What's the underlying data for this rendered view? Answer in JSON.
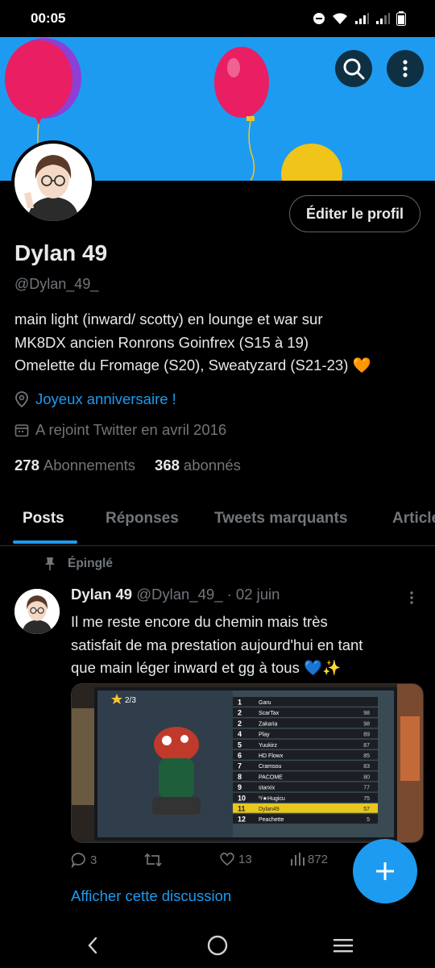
{
  "status_bar": {
    "time": "00:05"
  },
  "profile": {
    "edit_button": "Éditer le profil",
    "display_name": "Dylan 49",
    "handle": "@Dylan_49_",
    "bio_lines": [
      "main light (inward/ scotty) en lounge et war sur",
      "MK8DX  ancien Ronrons Goinfrex (S15 à 19)",
      "Omelette du Fromage (S20), Sweatyzard (S21-23) 🧡"
    ],
    "location": "Joyeux anniversaire !",
    "joined": "A rejoint Twitter en avril 2016",
    "following_count": "278",
    "following_label": "Abonnements",
    "followers_count": "368",
    "followers_label": "abonnés"
  },
  "tabs": [
    {
      "label": "Posts",
      "active": true
    },
    {
      "label": "Réponses",
      "active": false
    },
    {
      "label": "Tweets marquants",
      "active": false
    },
    {
      "label": "Articles",
      "active": false
    }
  ],
  "tweet": {
    "pinned_label": "Épinglé",
    "author_name": "Dylan 49",
    "author_handle": "@Dylan_49_",
    "date": "· 02 juin",
    "text_lines": [
      "Il me reste encore du chemin mais très",
      "satisfait de ma prestation aujourd'hui en tant",
      "que main léger inward et gg à tous 💙✨"
    ],
    "media": {
      "race_position": "2/3",
      "leaderboard": [
        {
          "rank": "1",
          "name": "Garu",
          "score": ""
        },
        {
          "rank": "2",
          "name": "ScarTax",
          "score": "98"
        },
        {
          "rank": "2",
          "name": "Zakaria",
          "score": "98"
        },
        {
          "rank": "4",
          "name": "Play",
          "score": "89"
        },
        {
          "rank": "5",
          "name": "Yuukirz",
          "score": "87"
        },
        {
          "rank": "6",
          "name": "HD Flowx",
          "score": "85"
        },
        {
          "rank": "7",
          "name": "Cramsou",
          "score": "83"
        },
        {
          "rank": "8",
          "name": "PACOME",
          "score": "80"
        },
        {
          "rank": "9",
          "name": "starxix",
          "score": "77"
        },
        {
          "rank": "10",
          "name": "⁰/★Hugicu",
          "score": "75"
        },
        {
          "rank": "11",
          "name": "Dylan49",
          "score": "57"
        },
        {
          "rank": "12",
          "name": "Peachette",
          "score": "5"
        }
      ]
    },
    "replies": "3",
    "retweets": "",
    "likes": "13",
    "views": "872",
    "show_thread": "Afficher cette discussion"
  },
  "colors": {
    "accent": "#1d9bf0",
    "background": "#000000",
    "banner": "#1d9bf0",
    "secondary_text": "#71767b"
  }
}
